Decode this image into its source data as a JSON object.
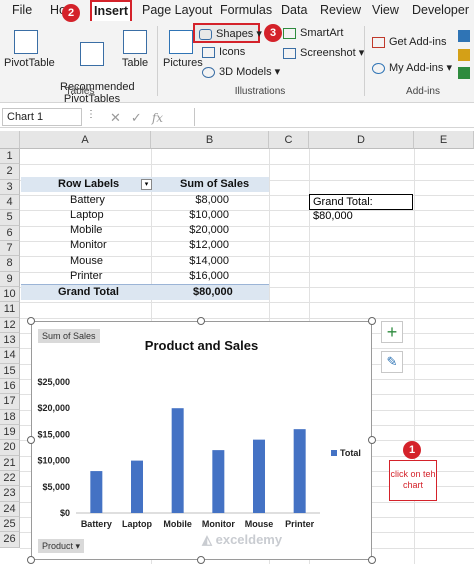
{
  "ribbon": {
    "tabs": [
      "File",
      "Ho",
      "Insert",
      "Page Layout",
      "Formulas",
      "Data",
      "Review",
      "View",
      "Developer"
    ],
    "badges": {
      "insert": "2",
      "shapes": "3",
      "chart": "1"
    },
    "tables_group": {
      "label": "Tables",
      "pivot": "PivotTable",
      "recommended": "Recommended\nPivotTables",
      "table": "Table"
    },
    "illustrations_group": {
      "label": "Illustrations",
      "pictures": "Pictures",
      "shapes": "Shapes",
      "icons": "Icons",
      "models": "3D Models",
      "smartart": "SmartArt",
      "screenshot": "Screenshot"
    },
    "addins_group": {
      "label": "Add-ins",
      "get": "Get Add-ins",
      "my": "My Add-ins"
    }
  },
  "formula_bar": {
    "name_box": "Chart 1",
    "fx": "fx"
  },
  "columns": [
    "A",
    "B",
    "C",
    "D",
    "E"
  ],
  "rows": [
    "1",
    "2",
    "3",
    "4",
    "5",
    "6",
    "7",
    "8",
    "9",
    "10",
    "11",
    "12",
    "13",
    "14",
    "15",
    "16",
    "17",
    "18",
    "19",
    "20",
    "21",
    "22",
    "23",
    "24",
    "25",
    "26"
  ],
  "pivot": {
    "header_row": "Row Labels",
    "header_value": "Sum of Sales",
    "rows": [
      {
        "label": "Battery",
        "value": "$8,000"
      },
      {
        "label": "Laptop",
        "value": "$10,000"
      },
      {
        "label": "Mobile",
        "value": "$20,000"
      },
      {
        "label": "Monitor",
        "value": "$12,000"
      },
      {
        "label": "Mouse",
        "value": "$14,000"
      },
      {
        "label": "Printer",
        "value": "$16,000"
      }
    ],
    "total_label": "Grand Total",
    "total_value": "$80,000"
  },
  "grand_total_box": "Grand Total: $80,000",
  "chart_data": {
    "type": "bar",
    "title": "Product and Sales",
    "categories": [
      "Battery",
      "Laptop",
      "Mobile",
      "Monitor",
      "Mouse",
      "Printer"
    ],
    "series": [
      {
        "name": "Total",
        "values": [
          8000,
          10000,
          20000,
          12000,
          14000,
          16000
        ]
      }
    ],
    "ylim": [
      0,
      25000
    ],
    "yticks": [
      "$0",
      "$5,000",
      "$10,000",
      "$15,000",
      "$20,000",
      "$25,000"
    ],
    "legend": "right",
    "grid": false,
    "bar_color": "#4472c4",
    "value_field_button": "Sum of Sales",
    "axis_field_button": "Product"
  },
  "callout_text": "click on teh chart",
  "watermark": "exceldemy"
}
